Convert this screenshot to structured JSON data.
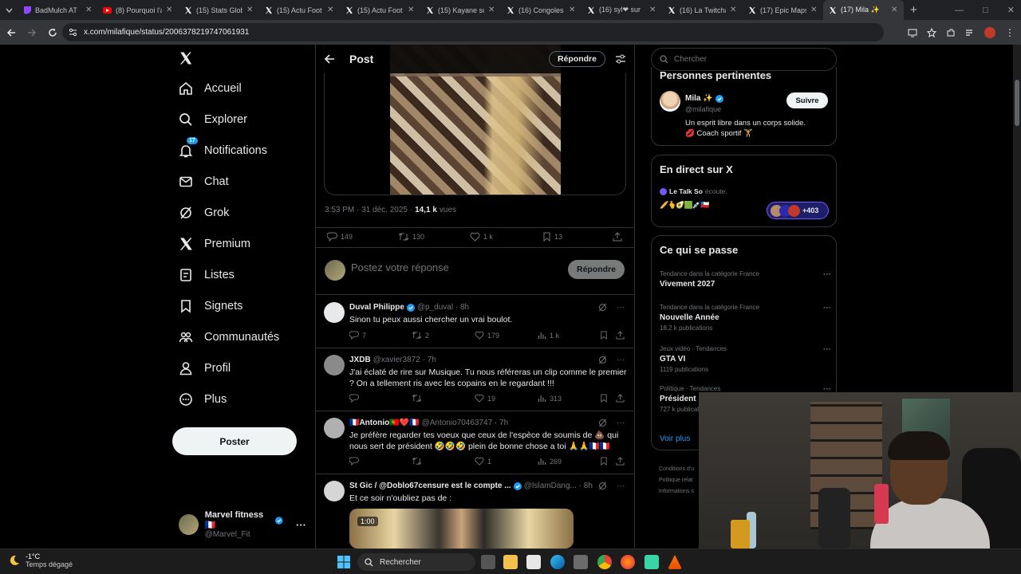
{
  "browser": {
    "tabs": [
      {
        "title": "BadMulch AT",
        "fav": "twitch",
        "color": "#9146ff"
      },
      {
        "title": "(8) Pourquoi l'a",
        "fav": "youtube",
        "color": "#ff0000"
      },
      {
        "title": "(15) Stats Glob",
        "fav": "x",
        "color": "#ffffff"
      },
      {
        "title": "(15) Actu Foot",
        "fav": "x",
        "color": "#ffffff"
      },
      {
        "title": "(15) Actu Foot",
        "fav": "x",
        "color": "#ffffff"
      },
      {
        "title": "(15) Kayane su",
        "fav": "x",
        "color": "#ffffff"
      },
      {
        "title": "(16) Congoles",
        "fav": "x",
        "color": "#ffffff"
      },
      {
        "title": "(16) syl❤ sur",
        "fav": "x",
        "color": "#ffffff"
      },
      {
        "title": "(16) La Twitcha",
        "fav": "x",
        "color": "#ffffff"
      },
      {
        "title": "(17) Epic Maps",
        "fav": "x",
        "color": "#ffffff"
      },
      {
        "title": "(17) Mila ✨",
        "fav": "x",
        "color": "#ffffff",
        "active": true
      }
    ],
    "url": "x.com/milafique/status/2006378219747061931"
  },
  "nav": {
    "items": [
      {
        "label": "Accueil",
        "icon": "home-icon"
      },
      {
        "label": "Explorer",
        "icon": "search-icon"
      },
      {
        "label": "Notifications",
        "icon": "bell-icon",
        "badge": "17"
      },
      {
        "label": "Chat",
        "icon": "mail-icon"
      },
      {
        "label": "Grok",
        "icon": "grok-icon"
      },
      {
        "label": "Premium",
        "icon": "x-icon"
      },
      {
        "label": "Listes",
        "icon": "list-icon"
      },
      {
        "label": "Signets",
        "icon": "bookmark-icon"
      },
      {
        "label": "Communautés",
        "icon": "communities-icon"
      },
      {
        "label": "Profil",
        "icon": "person-icon"
      },
      {
        "label": "Plus",
        "icon": "more-circle-icon"
      }
    ],
    "post_button": "Poster",
    "account": {
      "name": "Marvel fitness 🇫🇷",
      "handle": "@Marvel_Fit"
    }
  },
  "post": {
    "header_title": "Post",
    "header_reply": "Répondre",
    "time": "3:53 PM · 31 déc. 2025 ·",
    "views_count": "14,1 k",
    "views_label": "vues",
    "stats": {
      "replies": "149",
      "reposts": "130",
      "likes": "1 k",
      "bookmarks": "13"
    },
    "reply_placeholder": "Postez votre réponse",
    "reply_button": "Répondre"
  },
  "replies": [
    {
      "name": "Duval Philippe",
      "verified": true,
      "handle": "@p_duval · 8h",
      "text": "Sinon tu peux aussi chercher un vrai boulot.",
      "replies": "7",
      "reposts": "2",
      "likes": "179",
      "views": "1 k",
      "avatar_color": "#e7e9ea"
    },
    {
      "name": "JXDB",
      "verified": false,
      "handle": "@xavier3872 · 7h",
      "text": "J'ai éclaté de rire sur Musique. Tu nous référeras un clip comme le premier ? On a tellement ris avec les copains en le regardant !!!",
      "replies": "",
      "reposts": "",
      "likes": "19",
      "views": "313",
      "avatar_color": "#8a8a8a"
    },
    {
      "name": "🇫🇷Antonio🇵🇹❤️🇫🇷",
      "verified": false,
      "handle": "@Antonio70463747 · 7h",
      "text": "Je préfère regarder tes voeux que ceux de l'espèce de soumis de 💩 qui nous sert de président 🤣🤣🤣 plein de bonne chose a toi 🙏🙏🇫🇷🇫🇷",
      "replies": "",
      "reposts": "",
      "likes": "1",
      "views": "269",
      "avatar_color": "#b0b0b0"
    },
    {
      "name": "St Gic / @Doblo67censure est le compte ...",
      "verified": true,
      "handle": "@IslamDang... · 8h",
      "text": "Et ce soir n'oubliez pas de :",
      "embed_duration": "1:00",
      "avatar_color": "#d6d6d6"
    }
  ],
  "sidebar": {
    "search_placeholder": "Chercher",
    "who_title": "Personnes pertinentes",
    "who": {
      "name": "Mila ✨",
      "handle": "@milafique",
      "bio_line1": "Un esprit libre dans un corps solide.",
      "bio_line2": "💋 Coach sportif 🏋️",
      "follow": "Suivre"
    },
    "live_title": "En direct sur X",
    "live_host": "Le Talk So",
    "live_action": "écoute.",
    "live_emojis": "🥖🫰🥑🟩💉🇨🇱",
    "live_count": "+403",
    "trends_title": "Ce qui se passe",
    "trends": [
      {
        "context": "Tendance dans la catégorie France",
        "title": "Vivement 2027",
        "count": ""
      },
      {
        "context": "Tendance dans la catégorie France",
        "title": "Nouvelle Année",
        "count": "18,2 k publications"
      },
      {
        "context": "Jeux vidéo · Tendances",
        "title": "GTA VI",
        "count": "1119 publications"
      },
      {
        "context": "Politique · Tendances",
        "title": "Président",
        "count": "727 k publications"
      }
    ],
    "more_link": "Voir plus",
    "footer": [
      "Conditions d'u",
      "Politique relat",
      "Informations s"
    ]
  },
  "taskbar": {
    "temp": "-1°C",
    "weather": "Temps dégagé",
    "search": "Rechercher"
  }
}
